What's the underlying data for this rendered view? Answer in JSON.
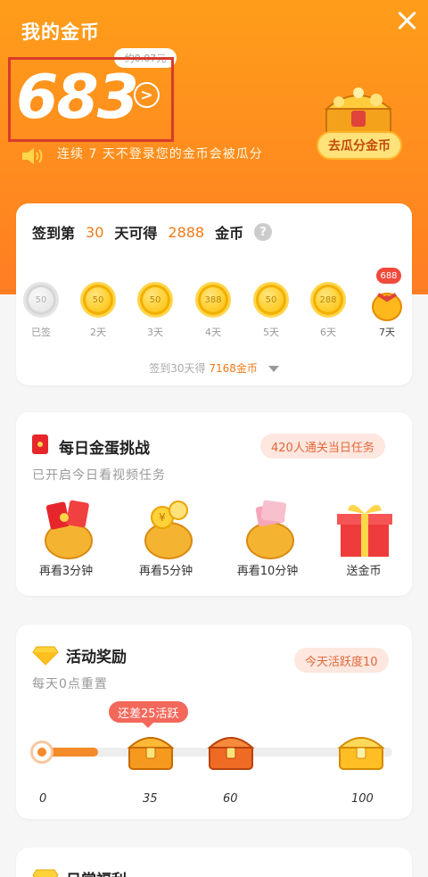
{
  "header": {
    "title": "我的金币",
    "approx_value": "约0.07元",
    "coin_count": "683",
    "notice": "连续 7 天不登录您的金币会被瓜分",
    "share_button": "去瓜分金币"
  },
  "signin": {
    "prefix": "签到第",
    "day_num": "30",
    "middle": "天可得",
    "reward": "2888",
    "suffix": "金币",
    "help": "?",
    "days": [
      {
        "value": "50",
        "label": "已签",
        "done": true
      },
      {
        "value": "50",
        "label": "2天",
        "done": false
      },
      {
        "value": "50",
        "label": "3天",
        "done": false
      },
      {
        "value": "388",
        "label": "4天",
        "done": false
      },
      {
        "value": "50",
        "label": "5天",
        "done": false
      },
      {
        "value": "288",
        "label": "6天",
        "done": false
      },
      {
        "value": "688",
        "label": "7天",
        "done": false
      }
    ],
    "footer_prefix": "签到30天得",
    "footer_highlight": "7168金币"
  },
  "egg_challenge": {
    "title": "每日金蛋挑战",
    "badge": "420人通关当日任务",
    "subtitle": "已开启今日看视频任务",
    "items": [
      {
        "label": "再看3分钟"
      },
      {
        "label": "再看5分钟"
      },
      {
        "label": "再看10分钟"
      },
      {
        "label": "送金币"
      }
    ]
  },
  "activity": {
    "title": "活动奖励",
    "badge": "今天活跃度10",
    "subtitle": "每天0点重置",
    "tip": "还差25活跃",
    "progress_value": 10,
    "progress_max": 100,
    "milestones": [
      "0",
      "35",
      "60",
      "100"
    ]
  },
  "daily": {
    "title": "日常福利"
  },
  "colors": {
    "hero_orange": "#ff8b1f",
    "accent": "#f07a18",
    "coin_gold": "#ffd23a",
    "highlight_red": "#d93b2b"
  }
}
